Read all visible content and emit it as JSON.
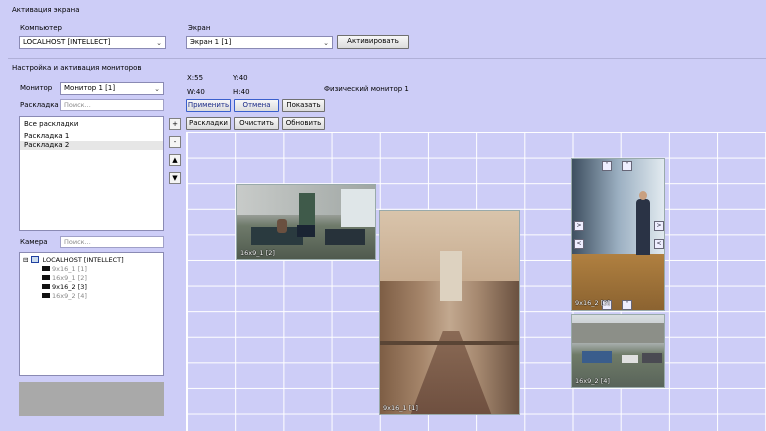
{
  "screen_activation": {
    "section_title": "Активация экрана",
    "computer_label": "Компьютер",
    "computer_value": "LOCALHOST [INTELLECT]",
    "screen_label": "Экран",
    "screen_value": "Экран 1 [1]",
    "activate_button": "Активировать"
  },
  "monitors": {
    "section_title": "Настройка и активация мониторов",
    "monitor_label": "Монитор",
    "monitor_value": "Монитор 1 [1]",
    "layout_label": "Раскладка",
    "layout_search_placeholder": "Поиск...",
    "layouts": [
      "Все раскладки",
      "Раскладка 1",
      "Раскладка 2"
    ],
    "side_buttons": [
      "+",
      "-",
      "▲",
      "▼"
    ],
    "camera_label": "Камера",
    "camera_search_placeholder": "Поиск...",
    "tree": {
      "root": "LOCALHOST [INTELLECT]",
      "cameras": [
        "9x16_1 [1]",
        "16x9_1 [2]",
        "9x16_2 [3]",
        "16x9_2 [4]"
      ]
    }
  },
  "geometry": {
    "x_text": "X:55",
    "y_text": "Y:40",
    "w_text": "W:40",
    "h_text": "H:40",
    "physical_monitor": "Физический монитор 1"
  },
  "toolbar": {
    "apply": "Применить",
    "cancel": "Отмена",
    "show": "Показать",
    "layouts": "Раскладки",
    "clear": "Очистить",
    "refresh": "Обновить"
  },
  "cameras": [
    {
      "label": "16x9_1 [2]"
    },
    {
      "label": "9x16_1 [1]"
    },
    {
      "label": "9x16_2 [3]"
    },
    {
      "label": "16x9_2 [4]"
    }
  ],
  "colors": {
    "background": "#cdcdf7",
    "grid_line": "#ffffff"
  }
}
